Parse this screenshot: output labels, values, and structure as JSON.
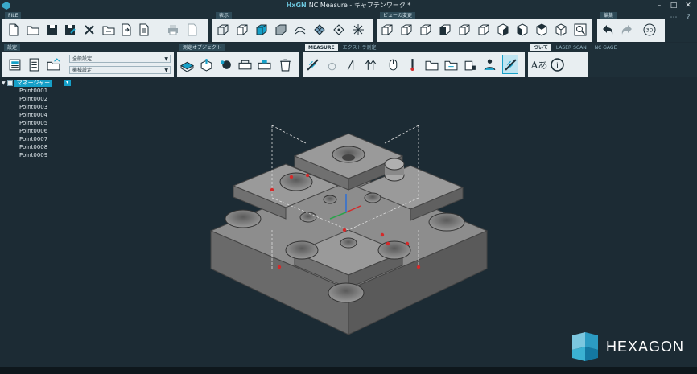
{
  "window": {
    "title": "HxGN NC Measure - キャプテンワーク *",
    "logo_text": "HxGN",
    "title_rest": "NC Measure - キャプテンワーク *",
    "controls": [
      "–",
      "□",
      "✕"
    ],
    "extra_buttons": [
      "⋯",
      "?"
    ]
  },
  "ribbon_row1": {
    "file": {
      "label": "FILE"
    },
    "view": {
      "label": "表示"
    },
    "view_change": {
      "label": "ビューの変更"
    },
    "edit": {
      "label": "編集"
    },
    "edit_3d_label": "3D"
  },
  "ribbon_row2": {
    "settings": {
      "label": "設定",
      "select1": "全般設定",
      "select2": "機械設定"
    },
    "measure_object": {
      "label": "測定オブジェクト"
    },
    "measure_tabs": [
      "MEASURE",
      "エクストラ測定"
    ],
    "about_tabs": [
      "ついて",
      "LASER SCAN",
      "NC GAGE"
    ],
    "about_icon_text": "Aあ",
    "info_icon_text": "i"
  },
  "tree": {
    "root_label": "マネージャー",
    "items": [
      "Point0001",
      "Point0002",
      "Point0003",
      "Point0004",
      "Point0005",
      "Point0006",
      "Point0007",
      "Point0008",
      "Point0009"
    ]
  },
  "brand": {
    "wordmark": "HEXAGON"
  },
  "colors": {
    "background": "#1c2b34",
    "ribbon": "#1e2f38",
    "toolbar_bar": "#e8eef1",
    "accent": "#16a0c8",
    "part_gray": "#8c8c8c",
    "point_red": "#d42a2a"
  }
}
